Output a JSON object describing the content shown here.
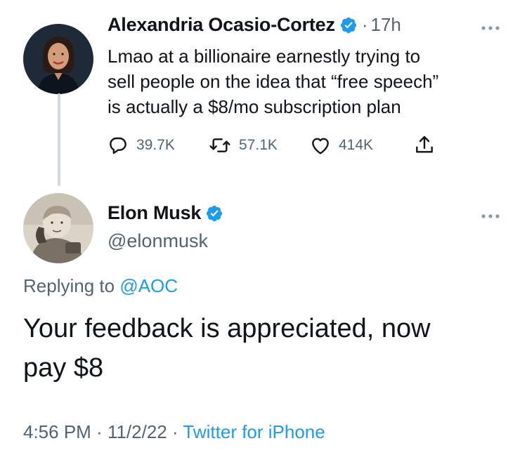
{
  "colors": {
    "text": "#0f1419",
    "secondary": "#536471",
    "accent": "#1d9bf0",
    "thread_line": "#cfd9de"
  },
  "parent_tweet": {
    "author_name": "Alexandria Ocasio-Cortez",
    "verified_icon": "verified-badge-icon",
    "separator": "·",
    "time_ago": "17h",
    "text_lines": [
      "Lmao at a billionaire earnestly trying to",
      "sell people on the idea that “free speech”",
      "is actually a $8/mo subscription plan"
    ],
    "stats": {
      "replies": "39.7K",
      "retweets": "57.1K",
      "likes": "414K"
    },
    "icons": [
      "reply-icon",
      "retweet-icon",
      "like-icon",
      "share-icon",
      "more-icon"
    ]
  },
  "reply_tweet": {
    "author_name": "Elon Musk",
    "handle": "@elonmusk",
    "replying_prefix": "Replying to ",
    "replying_to": "@AOC",
    "text_lines": [
      "Your feedback is appreciated, now",
      "pay $8"
    ],
    "meta": {
      "time": "4:56 PM",
      "sep1": " · ",
      "date": "11/2/22",
      "sep2": " · ",
      "source": "Twitter for iPhone"
    }
  }
}
